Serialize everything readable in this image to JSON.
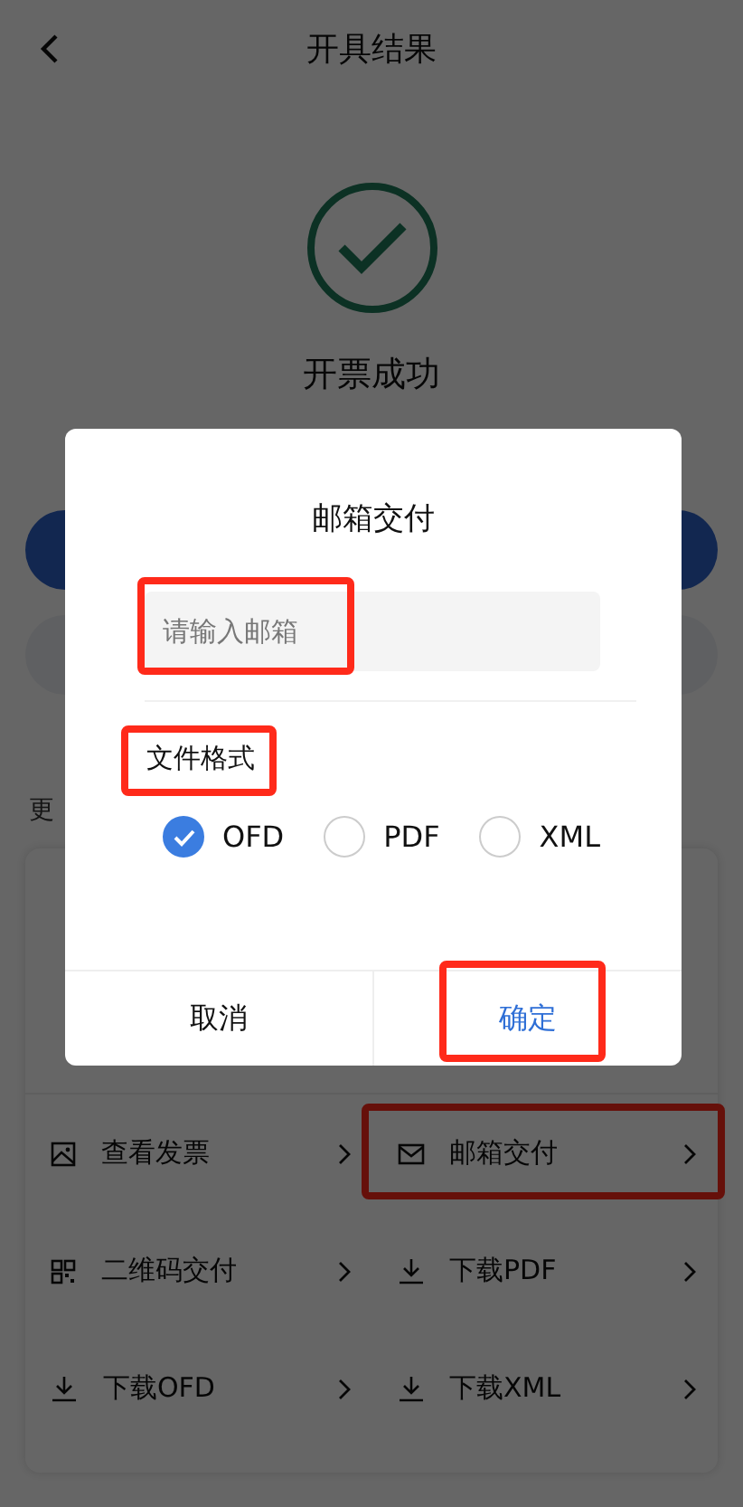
{
  "header": {
    "title": "开具结果"
  },
  "result": {
    "message": "开票成功"
  },
  "more_label": "更",
  "menu": [
    {
      "kind": "view",
      "label": "查看发票",
      "highlighted": false
    },
    {
      "kind": "email",
      "label": "邮箱交付",
      "highlighted": true
    },
    {
      "kind": "qrcode",
      "label": "二维码交付",
      "highlighted": false
    },
    {
      "kind": "download",
      "label": "下载PDF",
      "highlighted": false
    },
    {
      "kind": "download",
      "label": "下载OFD",
      "highlighted": false
    },
    {
      "kind": "download",
      "label": "下载XML",
      "highlighted": false
    }
  ],
  "dialog": {
    "title": "邮箱交付",
    "email": {
      "placeholder": "请输入邮箱",
      "highlighted": true
    },
    "format_label": {
      "text": "文件格式",
      "highlighted": true
    },
    "formats": [
      {
        "label": "OFD",
        "selected": true
      },
      {
        "label": "PDF",
        "selected": false
      },
      {
        "label": "XML",
        "selected": false
      }
    ],
    "buttons": [
      {
        "label": "取消",
        "kind": "cancel",
        "highlighted": false
      },
      {
        "label": "确定",
        "kind": "confirm",
        "highlighted": true
      }
    ]
  }
}
